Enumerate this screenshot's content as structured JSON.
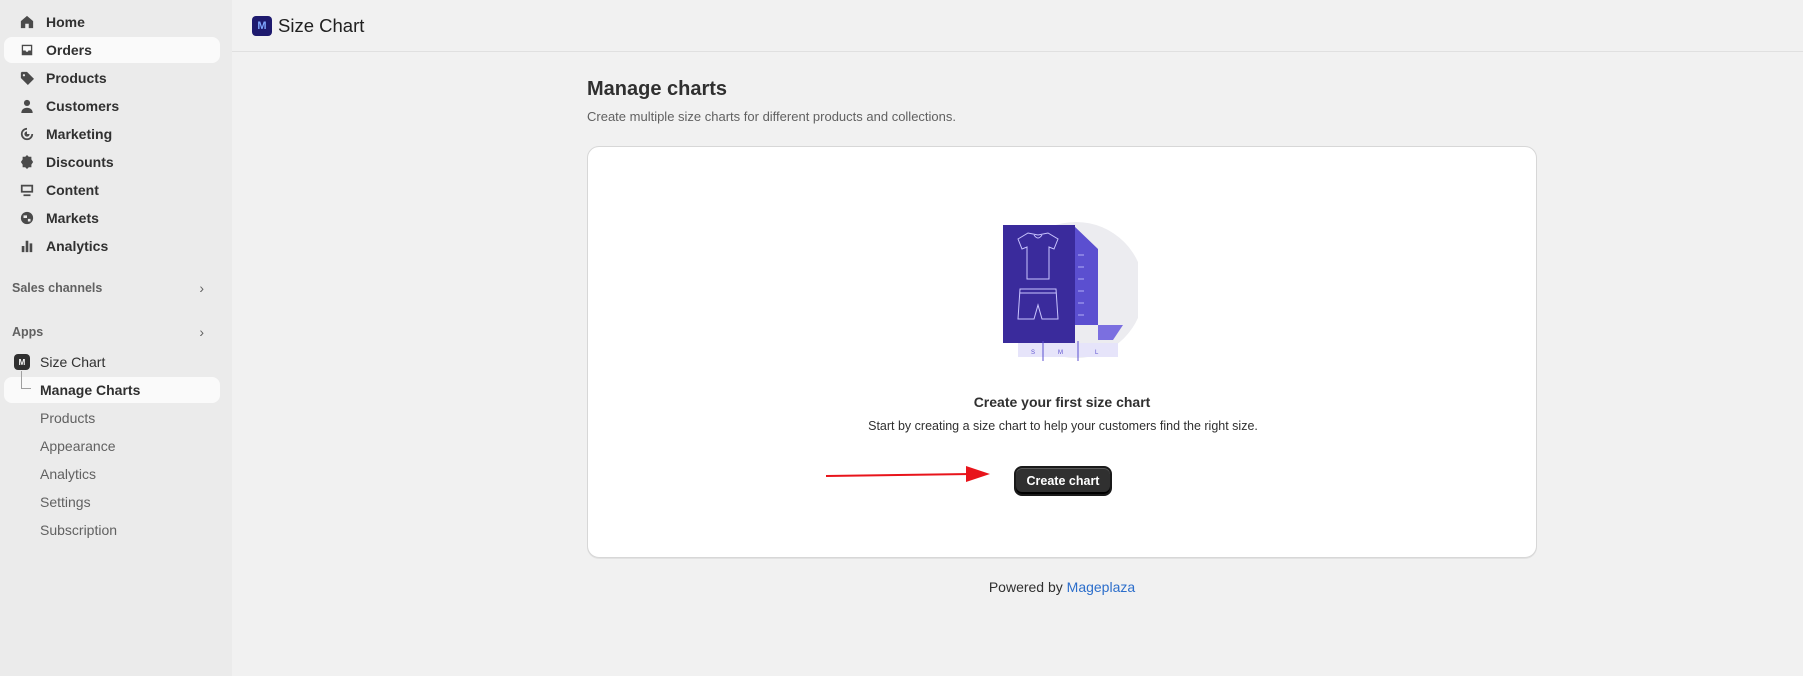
{
  "sidebar": {
    "nav": [
      {
        "label": "Home",
        "icon": "home-icon"
      },
      {
        "label": "Orders",
        "icon": "inbox-icon"
      },
      {
        "label": "Products",
        "icon": "tag-icon"
      },
      {
        "label": "Customers",
        "icon": "person-icon"
      },
      {
        "label": "Marketing",
        "icon": "target-icon"
      },
      {
        "label": "Discounts",
        "icon": "discount-icon"
      },
      {
        "label": "Content",
        "icon": "content-icon"
      },
      {
        "label": "Markets",
        "icon": "globe-icon"
      },
      {
        "label": "Analytics",
        "icon": "bar-chart-icon"
      }
    ],
    "sales_channels_label": "Sales channels",
    "apps_label": "Apps",
    "app_name": "Size Chart",
    "app_sub": [
      "Manage Charts",
      "Products",
      "Appearance",
      "Analytics",
      "Settings",
      "Subscription"
    ]
  },
  "topbar": {
    "title": "Size Chart"
  },
  "page": {
    "title": "Manage charts",
    "subtitle": "Create multiple size charts for different products and collections."
  },
  "empty_state": {
    "title": "Create your first size chart",
    "description": "Start by creating a size chart to help your customers find the right size.",
    "button": "Create chart",
    "size_labels": [
      "S",
      "M",
      "L"
    ]
  },
  "footer": {
    "prefix": "Powered by",
    "link": "Mageplaza"
  },
  "colors": {
    "accent_dark": "#303030",
    "illustration_purple": "#3a2b9c",
    "link": "#2c6ecb",
    "arrow": "#e8141b"
  }
}
